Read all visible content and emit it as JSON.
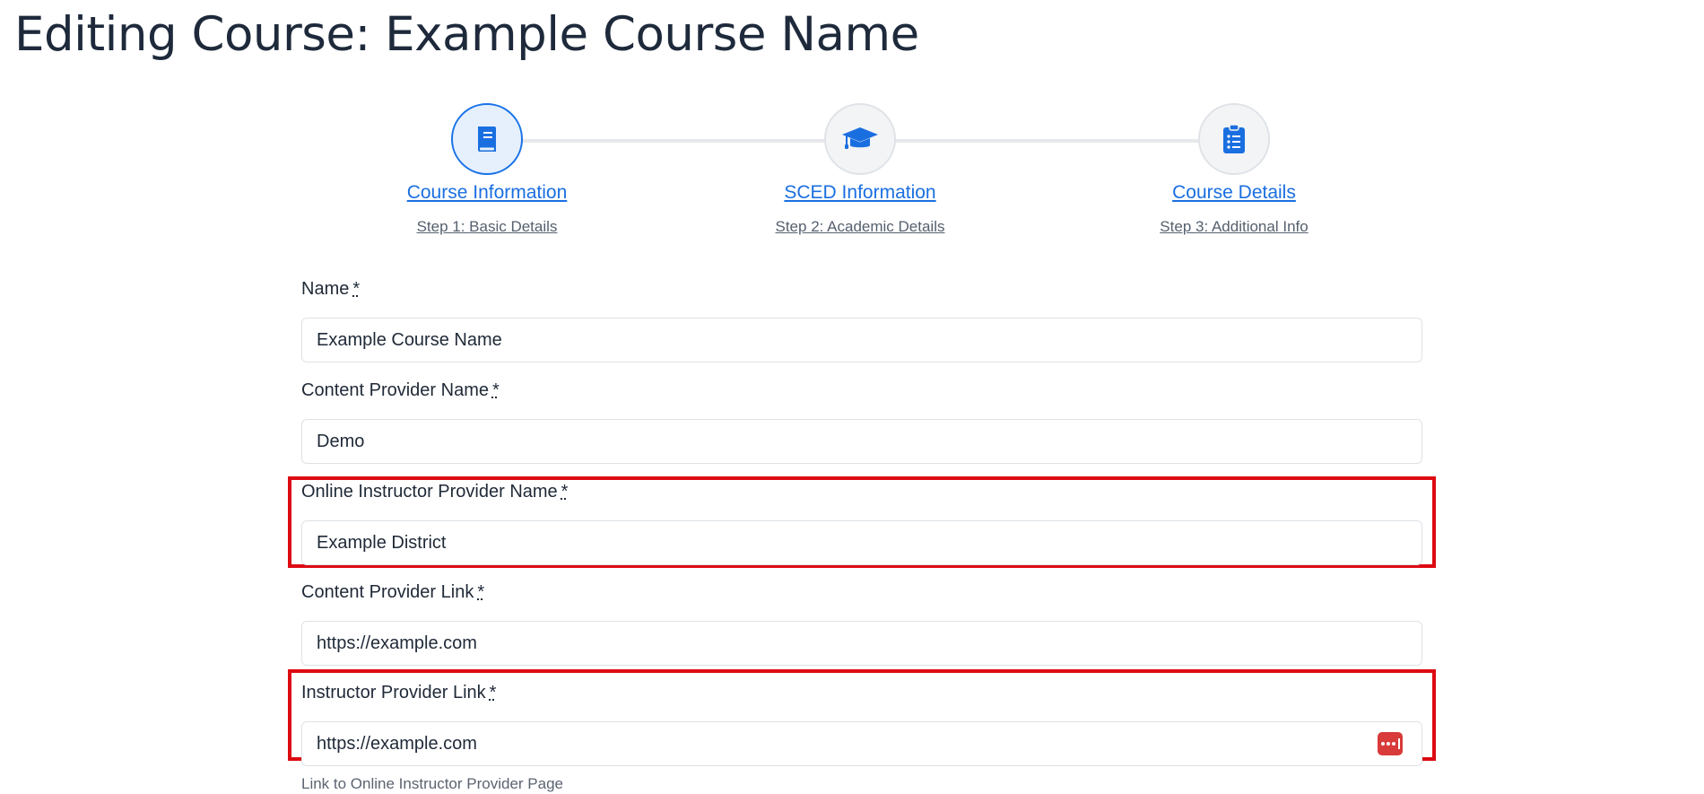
{
  "page": {
    "title": "Editing Course: Example Course Name"
  },
  "stepper": {
    "steps": [
      {
        "title": "Course Information",
        "subtitle": "Step 1: Basic Details",
        "icon": "book-icon",
        "active": true
      },
      {
        "title": "SCED Information",
        "subtitle": "Step 2: Academic Details",
        "icon": "graduation-cap-icon",
        "active": false
      },
      {
        "title": "Course Details",
        "subtitle": "Step 3: Additional Info",
        "icon": "clipboard-list-icon",
        "active": false
      }
    ]
  },
  "form": {
    "required_marker": "*",
    "fields": [
      {
        "label": "Name",
        "value": "Example Course Name"
      },
      {
        "label": "Content Provider Name",
        "value": "Demo"
      },
      {
        "label": "Online Instructor Provider Name",
        "value": "Example District"
      },
      {
        "label": "Content Provider Link",
        "value": "https://example.com"
      },
      {
        "label": "Instructor Provider Link",
        "value": "https://example.com",
        "help": "Link to Online Instructor Provider Page"
      }
    ]
  },
  "colors": {
    "accent": "#1a73e8",
    "highlight_border": "#dd0a12",
    "title_text": "#1e2a3b",
    "password_manager_icon": "#d93a3a"
  }
}
